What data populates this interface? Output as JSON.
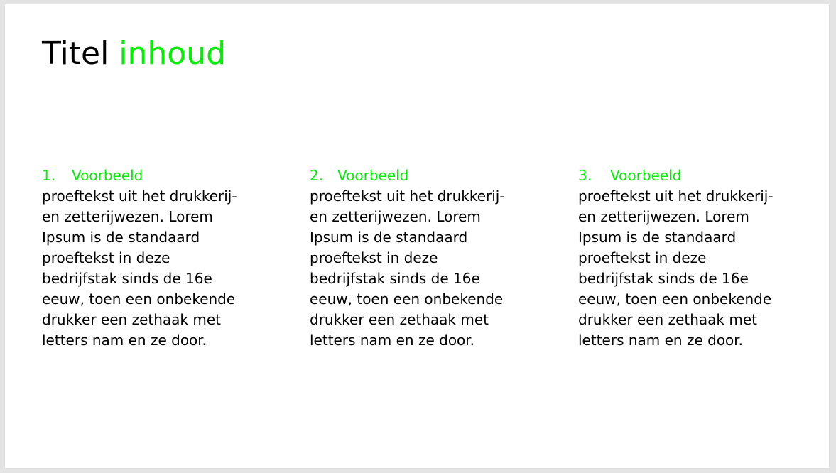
{
  "slide": {
    "title_prefix": "Titel",
    "title_accent": "inhoud",
    "accent_color": "#00ee00",
    "columns": [
      {
        "number": "1.",
        "heading": "Voorbeeld",
        "lines": [
          "proeftekst uit het drukkerij-",
          "en zetterijwezen. Lorem",
          "Ipsum is de standaard",
          "proeftekst in deze",
          "bedrijfstak sinds de 16e",
          "eeuw, toen een onbekende",
          "drukker een zethaak met",
          "letters nam en ze door."
        ]
      },
      {
        "number": "2.",
        "heading": "Voorbeeld",
        "lines": [
          "proeftekst uit het drukkerij-",
          "en zetterijwezen. Lorem",
          "Ipsum is de standaard",
          "proeftekst in deze",
          "bedrijfstak sinds de 16e",
          "eeuw, toen een onbekende",
          "drukker een zethaak met",
          "letters nam en ze door."
        ]
      },
      {
        "number": "3.",
        "heading": "Voorbeeld",
        "lines": [
          "proeftekst uit het drukkerij-",
          "en zetterijwezen. Lorem",
          "Ipsum is de standaard",
          "proeftekst in deze",
          "bedrijfstak sinds de 16e",
          "eeuw, toen een onbekende",
          "drukker een zethaak met",
          "letters nam en ze door."
        ]
      }
    ]
  }
}
